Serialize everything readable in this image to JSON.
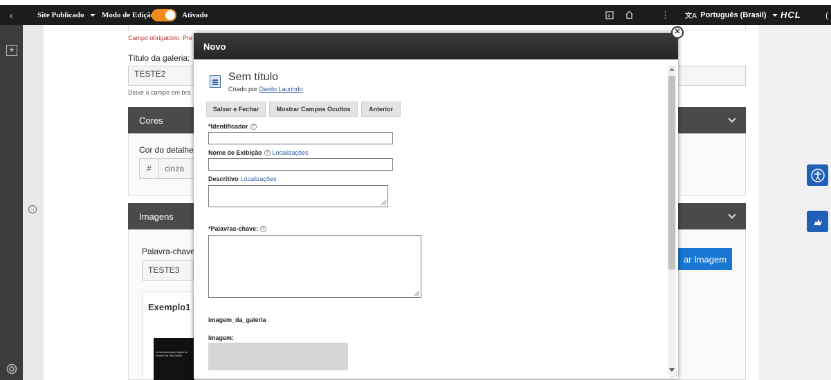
{
  "topbar": {
    "back_icon": "chevron-left-icon",
    "site_status": "Site Publicado",
    "edit_mode_label": "Modo de Edição:",
    "edit_mode_state": "Ativado",
    "language": "Português (Brasil)",
    "brand": "HCL",
    "accent_color": "#f08c1c"
  },
  "background": {
    "required_note": "Campo obrigatório. Pre",
    "gallery_title_label": "Título da galeria:",
    "gallery_title_value": "TESTE2",
    "gallery_hint": "Deixe o campo em bra",
    "colors_section": "Cores",
    "detail_color_label": "Cor do detalhe",
    "color_hash": "#",
    "color_value": "cinza",
    "images_section": "Imagens",
    "keyword_label": "Palavra-chave",
    "keyword_value": "TESTE3",
    "add_image_button": "ar Imagem",
    "example_title": "Exemplo1",
    "thumb_text": "A transformação digital do Estado de São Paulo"
  },
  "modal": {
    "title": "Novo",
    "doc_title": "Sem título",
    "created_by_label": "Criado por",
    "created_by_user": "Danilo Laurindo",
    "buttons": {
      "save_close": "Salvar e Fechar",
      "show_hidden": "Mostrar Campos Ocultos",
      "previous": "Anterior"
    },
    "fields": {
      "identifier_label": "*Identificador",
      "display_name_label": "Nome de Exibição",
      "display_name_localizations": "Localizações",
      "description_label": "Descritivo",
      "description_localizations": "Localizações",
      "keywords_label": "*Palavras-chave:",
      "gallery_image_label": "imagem_da_galeria",
      "image_label": "Imagem:"
    }
  }
}
